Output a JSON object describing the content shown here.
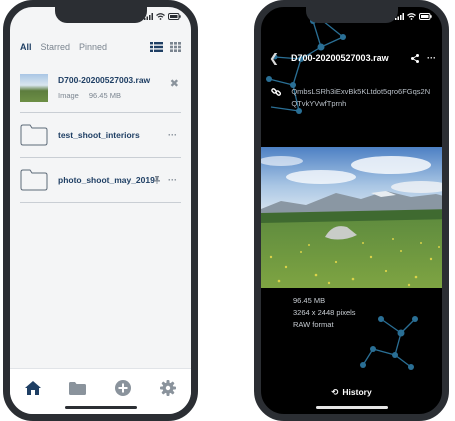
{
  "left_screen": {
    "tabs": [
      {
        "label": "All",
        "active": true
      },
      {
        "label": "Starred",
        "active": false
      },
      {
        "label": "Pinned",
        "active": false
      }
    ],
    "files": [
      {
        "type": "image",
        "name": "D700-20200527003.raw",
        "kind": "Image",
        "size": "96.45 MB"
      },
      {
        "type": "folder",
        "name": "test_shoot_interiors"
      },
      {
        "type": "folder",
        "name": "photo_shoot_may_2019",
        "pinned": true
      }
    ],
    "nav": [
      "home-icon",
      "folder-icon",
      "add-circle-icon",
      "gear-icon"
    ],
    "colors": {
      "accent": "#1f3f64",
      "muted": "#7b8590",
      "divider": "#c9ced4"
    }
  },
  "right_screen": {
    "title": "D700-20200527003.raw",
    "cid": "QmbsLSRh3iExvBk5KLtdot5qro6FGqs2NQTvkYVwfTprnh",
    "details": {
      "size": "96.45 MB",
      "dimensions": "3264 x 2448 pixels",
      "format": "RAW format"
    },
    "history_label": "History",
    "colors": {
      "network": "#2a6f95",
      "background": "#000000"
    }
  }
}
